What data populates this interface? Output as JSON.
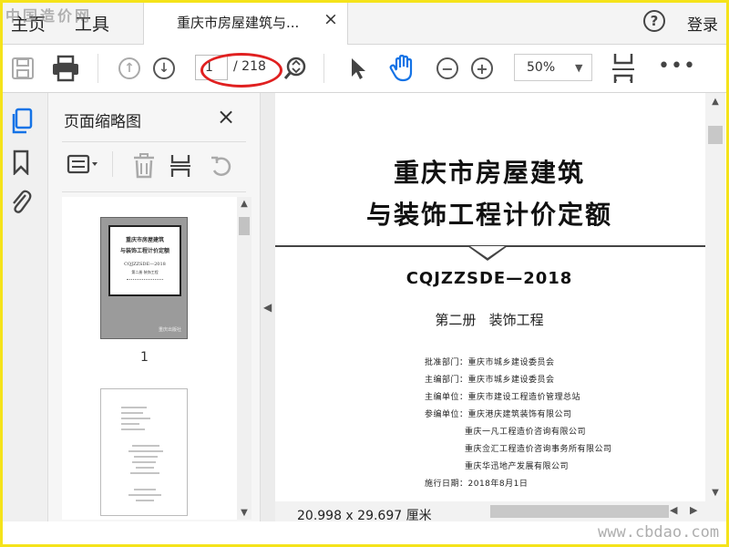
{
  "watermark": {
    "top": "中国造价网",
    "bottom": "www.cbdao.com"
  },
  "menu": {
    "home": "主页",
    "tools": "工具",
    "login": "登录",
    "help": "?"
  },
  "tab": {
    "title": "重庆市房屋建筑与...",
    "close": "×"
  },
  "toolbar": {
    "current_page": "1",
    "total_pages": "/ 218",
    "zoom": "50%",
    "more": "•••"
  },
  "panel": {
    "title": "页面缩略图",
    "close": "×",
    "thumbnails": [
      {
        "page_label": "1"
      },
      {
        "page_label": ""
      }
    ],
    "thumb1_lines": [
      "重庆市房屋建筑",
      "与装饰工程计价定额",
      "CQJZZSDE—2018",
      "第二册 装饰工程"
    ],
    "thumb1_footer": "重庆出版社"
  },
  "document": {
    "title_line1": "重庆市房屋建筑",
    "title_line2": "与装饰工程计价定额",
    "code": "CQJZZSDE—2018",
    "volume": "第二册   装饰工程",
    "approval": "批准部门：重庆市城乡建设委员会",
    "editor_dept": "主编部门：重庆市城乡建设委员会",
    "editor_unit": "主编单位：重庆市建设工程造价管理总站",
    "participants_label": "参编单位：重庆港庆建筑装饰有限公司",
    "participants": [
      "重庆一凡工程造价咨询有限公司",
      "重庆佥汇工程造价咨询事务所有限公司",
      "重庆华迅地产发展有限公司"
    ],
    "effective_date": "施行日期：2018年8月1日"
  },
  "statusbar": {
    "page_size": "20.998 x 29.697 厘米"
  },
  "colors": {
    "accent": "#1473e6",
    "annotation": "#e02020",
    "frame": "#f5e31a"
  }
}
